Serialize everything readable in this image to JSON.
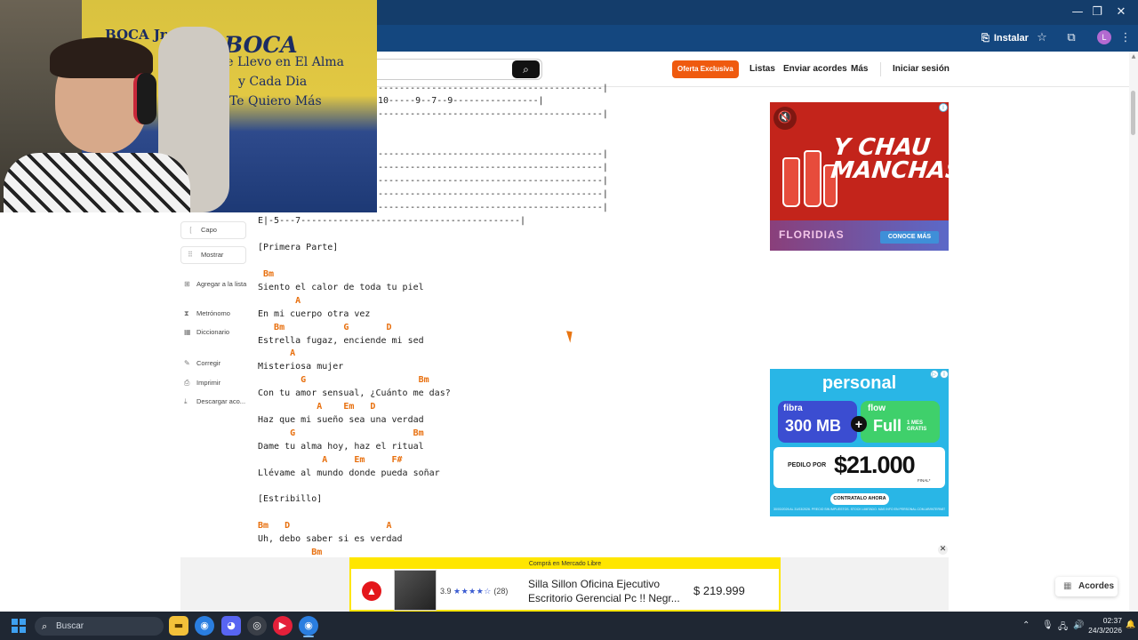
{
  "browser": {
    "install_label": "Instalar",
    "profile_initial": "L"
  },
  "webcam": {
    "flag_line1": "BOCA Jrs.",
    "flag_line2": "BOCA",
    "flag_line3": "Te Llevo en El Alma",
    "flag_line4": "y Cada Dia",
    "flag_line5": "Te Quiero Más"
  },
  "header": {
    "oferta": "Oferta Exclusiva",
    "nav": [
      "Listas",
      "Enviar acordes",
      "Más",
      "Iniciar sesión"
    ]
  },
  "tools": {
    "capo": "Capo",
    "mostrar": "Mostrar",
    "agregar": "Agregar a la lista",
    "metronomo": "Metrónomo",
    "diccionario": "Diccionario",
    "corregir": "Corregir",
    "imprimir": "Imprimir",
    "descargar": "Descargar aco..."
  },
  "tab": {
    "line_a": "------------------------------------------|",
    "line_b": "10-----9--7--9----------------|",
    "line_c": "------------------------------------------|",
    "line_d": "------------------------------------------|",
    "line_e": "------------------------------------------|",
    "line_f": "------------------------------------------|",
    "line_g": "------------------------------------------|",
    "line_h": "------------------------------------------|",
    "line_last": "E|-5---7-----------------------------------------|"
  },
  "song": {
    "section1": "[Primera Parte]",
    "c1": " Bm",
    "l1": "Siento el calor de toda tu piel",
    "c2": "       A",
    "l2": "En mi cuerpo otra vez",
    "c3": "   Bm           G       D",
    "l3": "Estrella fugaz, enciende mi sed",
    "c4": "      A",
    "l4": "Misteriosa mujer",
    "c5": "        G                     Bm",
    "l5": "Con tu amor sensual, ¿Cuánto me das?",
    "c6": "           A    Em   D",
    "l6": "Haz que mi sueño sea una verdad",
    "c7": "      G                      Bm",
    "l7": "Dame tu alma hoy, haz el ritual",
    "c8": "            A     Em     F#",
    "l8": "Llévame al mundo donde pueda soñar",
    "section2": "[Estribillo]",
    "c9": "Bm   D                  A",
    "l9": "Uh, debo saber si es verdad",
    "c10": "          Bm"
  },
  "ad1": {
    "title": "Y CHAU MANCHAS",
    "brand": "FLORIDIAS",
    "cta": "CONOCE MÁS"
  },
  "ad2": {
    "brand": "personal",
    "fibra": "fibra",
    "mb": "300 MB",
    "flow": "flow",
    "full": "Full",
    "gratis": "1 MES GRATIS",
    "pedilo": "PEDILO POR",
    "price": "$21.000",
    "final": "FINAL*",
    "cta": "CONTRATALO AHORA",
    "legal": "30/03/2026 AL 31/03/2026. PRECIO SIN IMPUESTOS. STOCK LIMITADO. MÁS INFO EN PERSONAL.COM.AR/INTERNET"
  },
  "ml_ad": {
    "header": "Comprá en Mercado Libre",
    "rating": "3.9",
    "reviews": "(28)",
    "title": "Silla Sillon Oficina Ejecutivo Escritorio Gerencial Pc !! Negr...",
    "price": "$ 219.999"
  },
  "acordes_button": "Acordes",
  "taskbar": {
    "search_placeholder": "Buscar",
    "time": "02:37",
    "date": "24/3/2026"
  }
}
